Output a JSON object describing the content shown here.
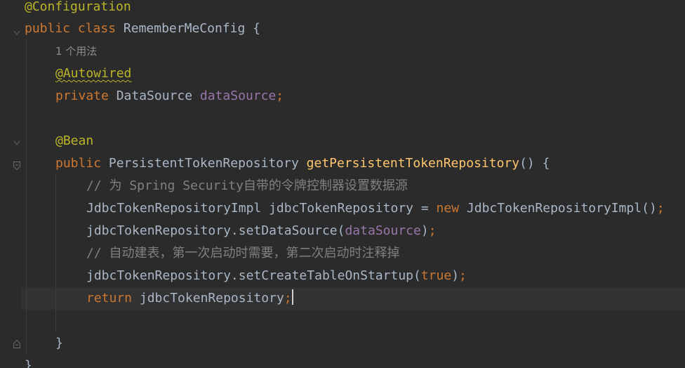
{
  "editor": {
    "language": "java",
    "colors": {
      "background": "#2b2b2b",
      "keyword": "#cc7832",
      "annotation": "#bbb529",
      "field": "#9876aa",
      "method": "#ffc66d",
      "comment": "#808080",
      "text": "#a9b7c6"
    },
    "lines": {
      "l1_annotation": "@Configuration",
      "l2_kw_public": "public",
      "l2_kw_class": "class",
      "l2_class_name": "RememberMeConfig",
      "l2_brace": "{",
      "l3_usage_hint": "1 个用法",
      "l4_annotation": "@Autowired",
      "l5_kw_private": "private",
      "l5_type": "DataSource",
      "l5_field": "dataSource",
      "l5_semicolon": ";",
      "l7_annotation": "@Bean",
      "l8_kw_public": "public",
      "l8_type": "PersistentTokenRepository",
      "l8_method": "getPersistentTokenRepository",
      "l8_tail": "() {",
      "l9_comment": "// 为 Spring Security自带的令牌控制器设置数据源",
      "l10_type": "JdbcTokenRepositoryImpl",
      "l10_var": "jdbcTokenRepository",
      "l10_eq": "=",
      "l10_kw_new": "new",
      "l10_ctor": "JdbcTokenRepositoryImpl()",
      "l10_semicolon": ";",
      "l11_call": "jdbcTokenRepository.setDataSource(",
      "l11_field": "dataSource",
      "l11_close": ")",
      "l11_semicolon": ";",
      "l12_comment": "// 自动建表，第一次启动时需要，第二次启动时注释掉",
      "l13_call": "jdbcTokenRepository.setCreateTableOnStartup(",
      "l13_kw_true": "true",
      "l13_close": ")",
      "l13_semicolon": ";",
      "l14_kw_return": "return",
      "l14_var": "jdbcTokenRepository",
      "l14_semicolon": ";",
      "l16_brace": "}",
      "l17_brace": "}"
    }
  }
}
